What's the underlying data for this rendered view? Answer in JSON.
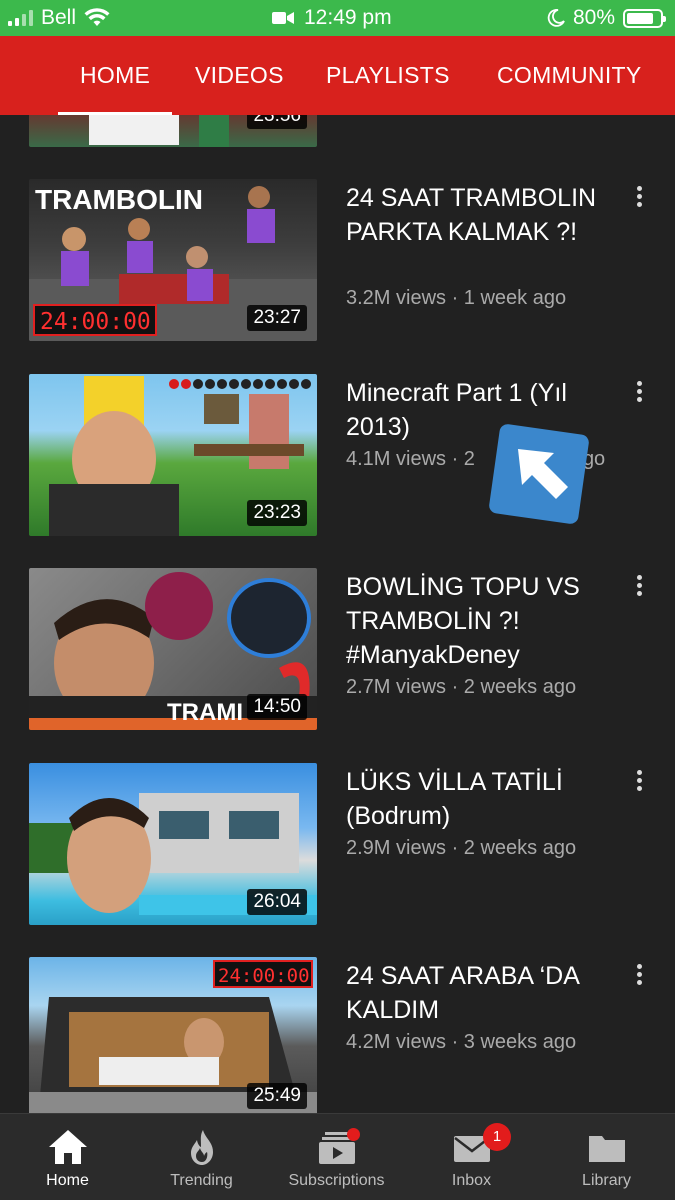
{
  "status_bar": {
    "carrier": "Bell",
    "time": "12:49 pm",
    "battery_percent": "80%",
    "battery_level": 0.8,
    "background_color": "#3cb94c"
  },
  "tabs": [
    {
      "label": "HOME",
      "active": true
    },
    {
      "label": "VIDEOS",
      "active": false
    },
    {
      "label": "PLAYLISTS",
      "active": false
    },
    {
      "label": "COMMUNITY",
      "active": false
    }
  ],
  "accent_color": "#d8211d",
  "videos": [
    {
      "title": "",
      "meta": "",
      "duration": "23:56",
      "partial": true
    },
    {
      "title": "24 SAAT TRAMBOLIN PARKTA KALMAK ?!",
      "meta": "3.2M views · 1 week ago",
      "duration": "23:27",
      "thumb_text": "TRAMBOLIN",
      "thumb_timer": "24:00:00"
    },
    {
      "title": "Minecraft Part 1 (Yıl 2013)",
      "meta": "4.1M views · 2",
      "meta_tail": "go",
      "duration": "23:23"
    },
    {
      "title": "BOWLİNG TOPU VS TRAMBOLİN ?! #ManyakDeney",
      "meta": "2.7M views · 2 weeks ago",
      "duration": "14:50",
      "thumb_text": "TRAMI"
    },
    {
      "title": "LÜKS VİLLA TATİLİ (Bodrum)",
      "meta": "2.9M views · 2 weeks ago",
      "duration": "26:04"
    },
    {
      "title": "24 SAAT ARABA ‘DA KALDIM",
      "meta": "4.2M views · 3 weeks ago",
      "duration": "25:49",
      "thumb_timer": "24:00:00"
    }
  ],
  "bottom_nav": [
    {
      "label": "Home",
      "icon": "home-icon",
      "active": true
    },
    {
      "label": "Trending",
      "icon": "flame-icon",
      "active": false
    },
    {
      "label": "Subscriptions",
      "icon": "subscriptions-icon",
      "active": false,
      "dot": true
    },
    {
      "label": "Inbox",
      "icon": "mail-icon",
      "active": false,
      "badge": "1"
    },
    {
      "label": "Library",
      "icon": "folder-icon",
      "active": false
    }
  ]
}
